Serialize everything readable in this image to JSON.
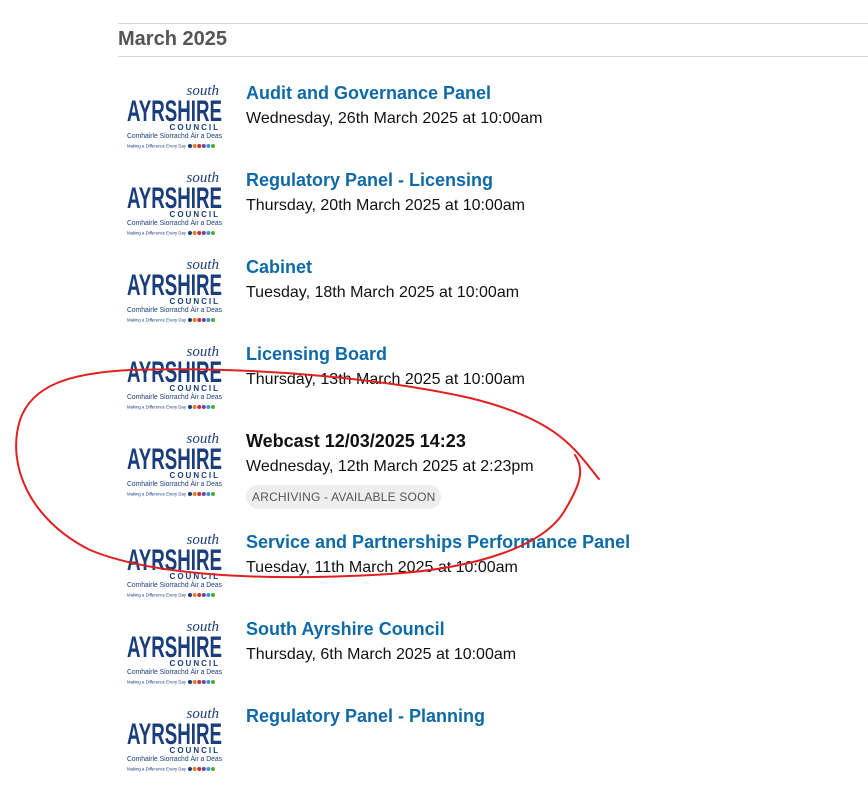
{
  "month_heading": "March 2025",
  "logo": {
    "line_south": "south",
    "line_ayrshire": "AYRSHIRE",
    "line_council": "COUNCIL",
    "line_gaelic": "Comhairle Siorrachd Àir a Deas",
    "line_tagline": "Making a Difference Every Day",
    "brand_color": "#1a3d7c",
    "dot_colors": [
      "#1a3d7c",
      "#e07b39",
      "#c0392b",
      "#7b3fa0",
      "#2e9fd6",
      "#5aa832"
    ]
  },
  "events": [
    {
      "title": "Audit and Governance Panel",
      "date": "Wednesday, 26th March 2025 at 10:00am",
      "link": true
    },
    {
      "title": "Regulatory Panel - Licensing",
      "date": "Thursday, 20th March 2025 at 10:00am",
      "link": true
    },
    {
      "title": "Cabinet",
      "date": "Tuesday, 18th March 2025 at 10:00am",
      "link": true
    },
    {
      "title": "Licensing Board",
      "date": "Thursday, 13th March 2025 at 10:00am",
      "link": true
    },
    {
      "title": "Webcast 12/03/2025 14:23",
      "date": "Wednesday, 12th March 2025 at 2:23pm",
      "link": false,
      "badge": "ARCHIVING - AVAILABLE SOON"
    },
    {
      "title": "Service and Partnerships Performance Panel",
      "date": "Tuesday, 11th March 2025 at 10:00am",
      "link": true
    },
    {
      "title": "South Ayrshire Council",
      "date": "Thursday, 6th March 2025 at 10:00am",
      "link": true
    },
    {
      "title": "Regulatory Panel - Planning",
      "date": "",
      "link": true
    }
  ],
  "colors": {
    "link": "#0e6aa7",
    "annotation": "#e02020"
  }
}
